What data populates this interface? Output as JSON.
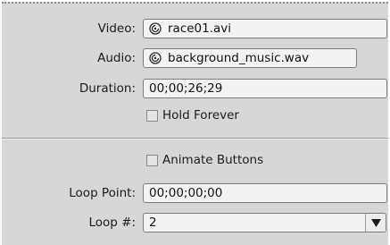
{
  "video": {
    "label": "Video:",
    "value": "race01.avi",
    "icon": "media-link-icon"
  },
  "audio": {
    "label": "Audio:",
    "value": "background_music.wav",
    "icon": "media-link-icon"
  },
  "duration": {
    "label": "Duration:",
    "value": "00;00;26;29"
  },
  "hold_forever": {
    "label": "Hold Forever",
    "checked": false
  },
  "animate_buttons": {
    "label": "Animate Buttons",
    "checked": false
  },
  "loop_point": {
    "label": "Loop Point:",
    "value": "00;00;00;00"
  },
  "loop_count": {
    "label": "Loop #:",
    "value": "2",
    "icon": "dropdown-arrow-icon"
  }
}
